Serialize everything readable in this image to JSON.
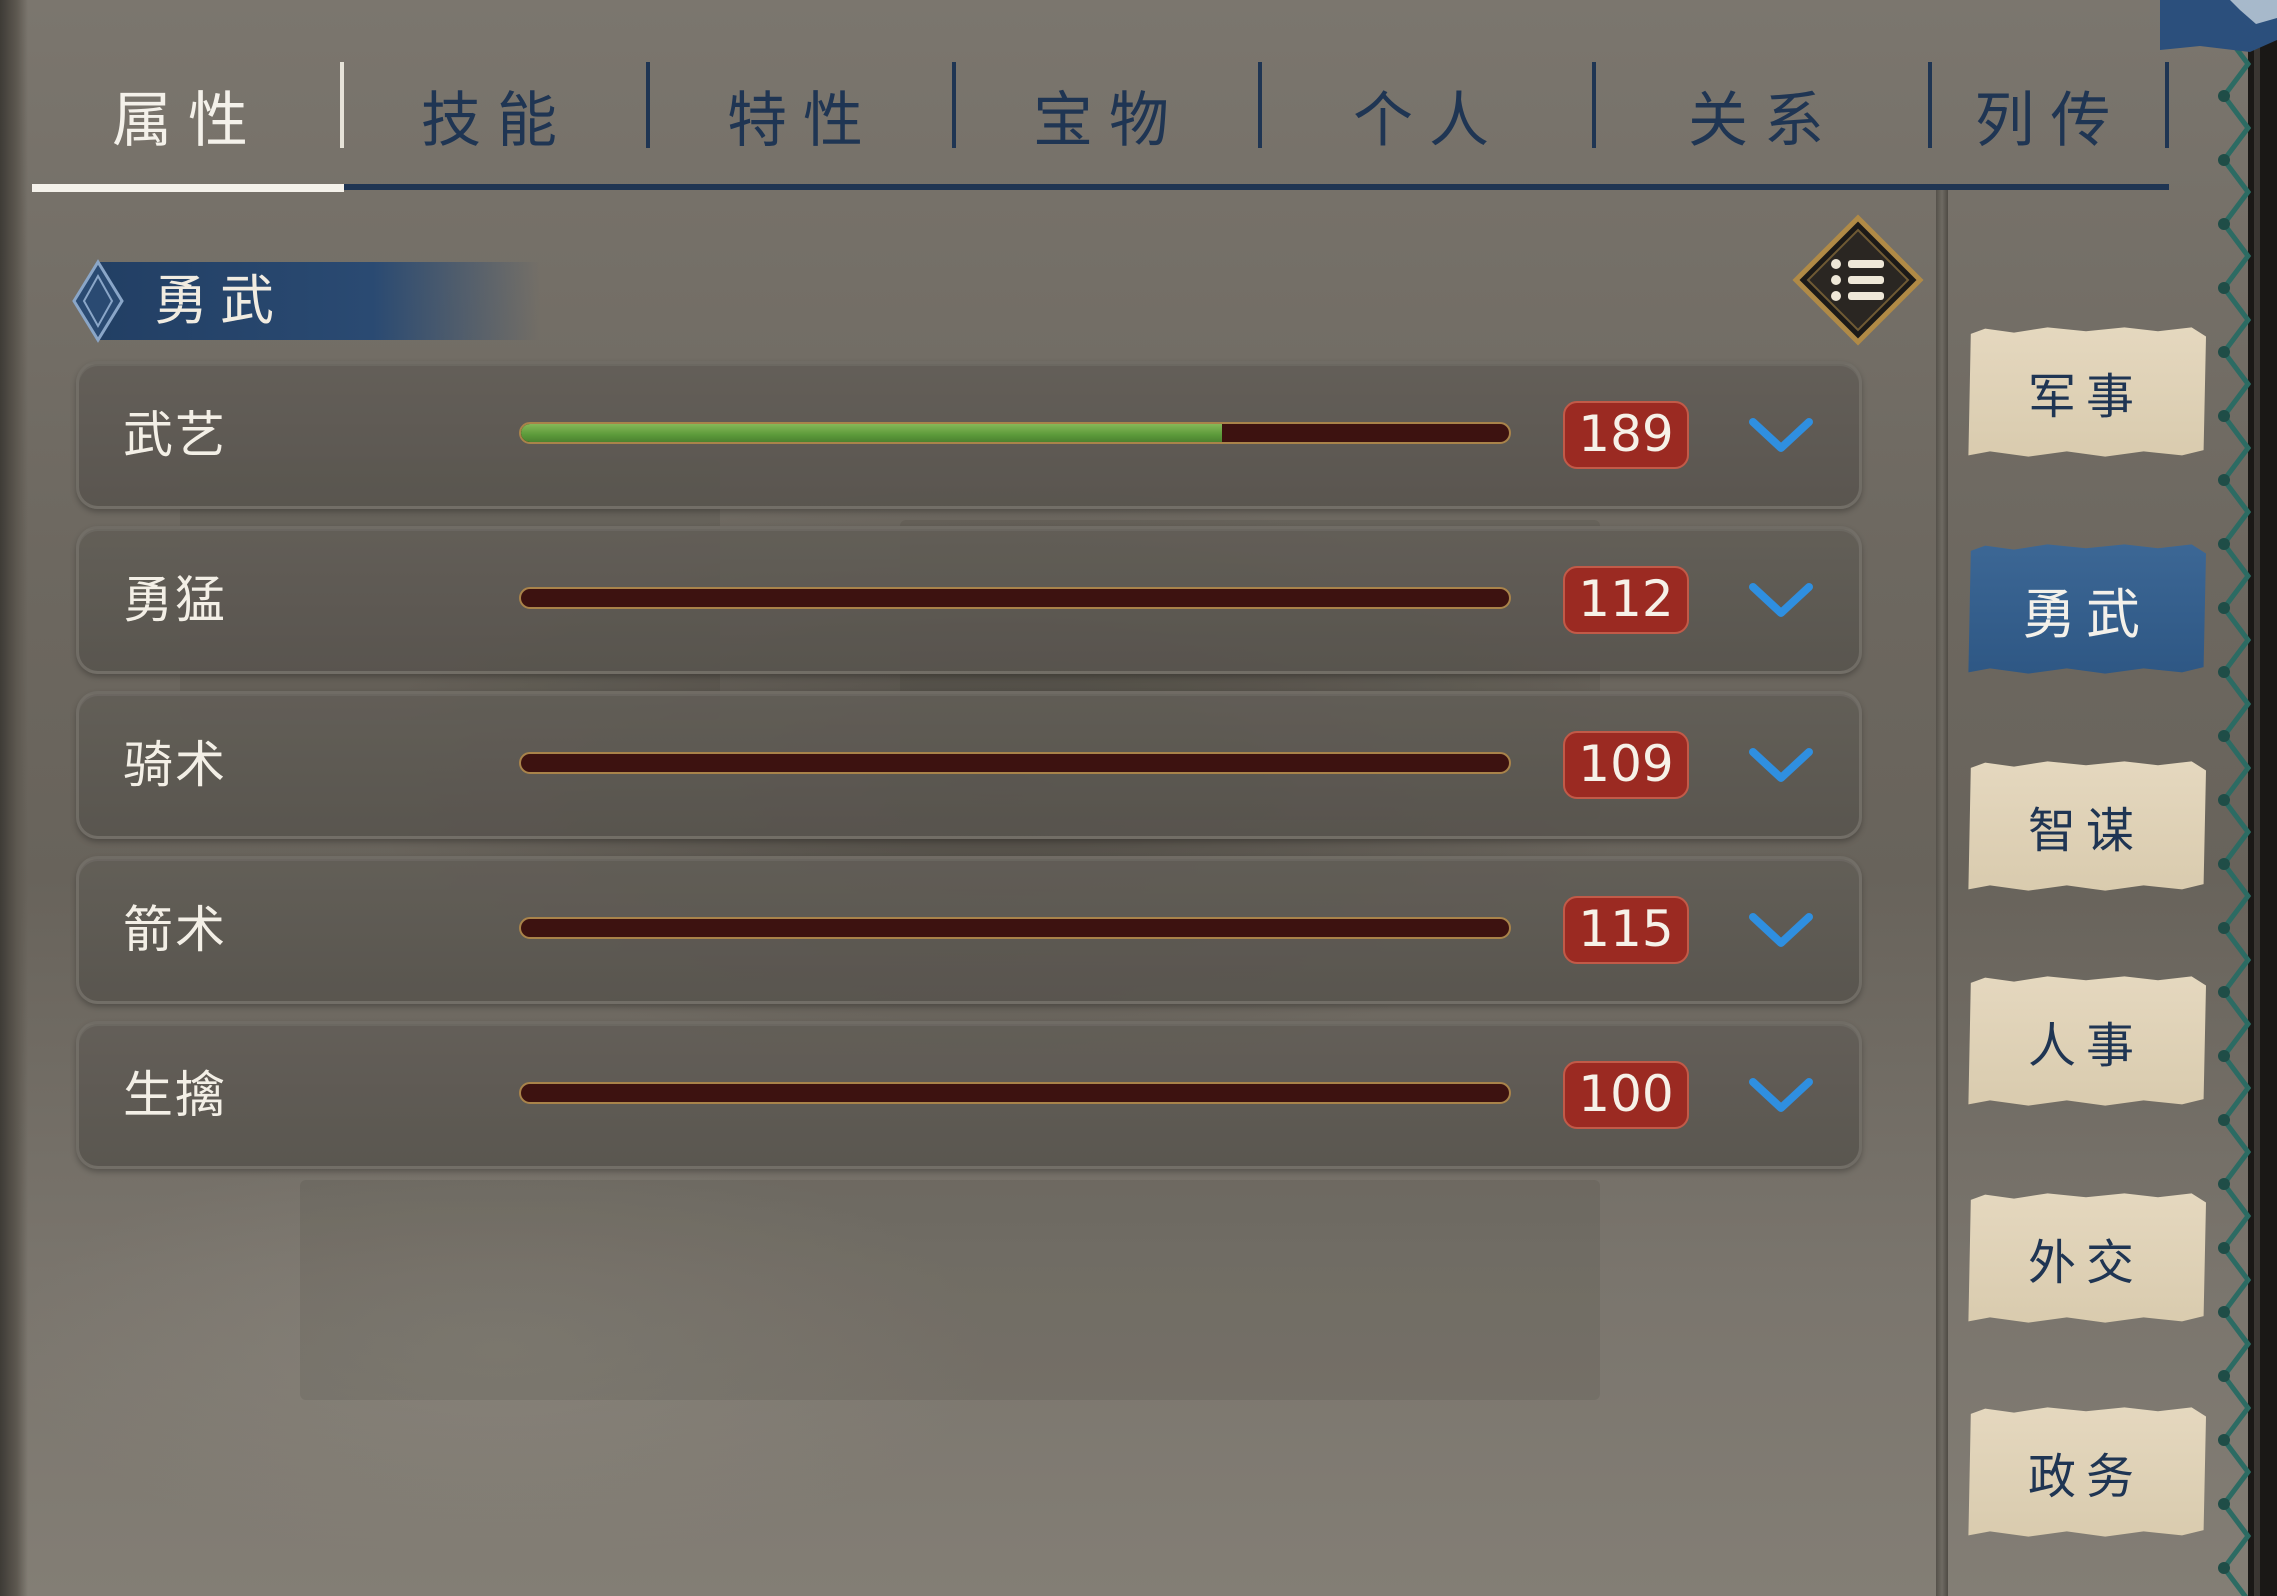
{
  "tabs": [
    {
      "label": "属性",
      "active": true
    },
    {
      "label": "技能",
      "active": false
    },
    {
      "label": "特性",
      "active": false
    },
    {
      "label": "宝物",
      "active": false
    },
    {
      "label": "个人",
      "active": false
    },
    {
      "label": "关系",
      "active": false
    },
    {
      "label": "列传",
      "active": false
    }
  ],
  "section": {
    "title": "勇武"
  },
  "list_button": {
    "icon": "list-icon"
  },
  "stats": [
    {
      "label": "武艺",
      "value": "189",
      "bar_fraction": 0.71
    },
    {
      "label": "勇猛",
      "value": "112",
      "bar_fraction": 0
    },
    {
      "label": "骑术",
      "value": "109",
      "bar_fraction": 0
    },
    {
      "label": "箭术",
      "value": "115",
      "bar_fraction": 0
    },
    {
      "label": "生擒",
      "value": "100",
      "bar_fraction": 0
    }
  ],
  "side_categories": [
    {
      "label": "军事",
      "active": false
    },
    {
      "label": "勇武",
      "active": true
    },
    {
      "label": "智谋",
      "active": false
    },
    {
      "label": "人事",
      "active": false
    },
    {
      "label": "外交",
      "active": false
    },
    {
      "label": "政务",
      "active": false
    }
  ],
  "colors": {
    "navy": "#1f3553",
    "active_tab_text": "#f4f1ea",
    "bar_fill_green": "#5c9a3a",
    "bar_track": "#3d1210",
    "value_badge": "#9b2a22",
    "chevron_blue": "#2f8fe0",
    "side_active": "#2e5784",
    "side_paper": "#e0d2b6",
    "binding_teal": "#2c6b63"
  }
}
